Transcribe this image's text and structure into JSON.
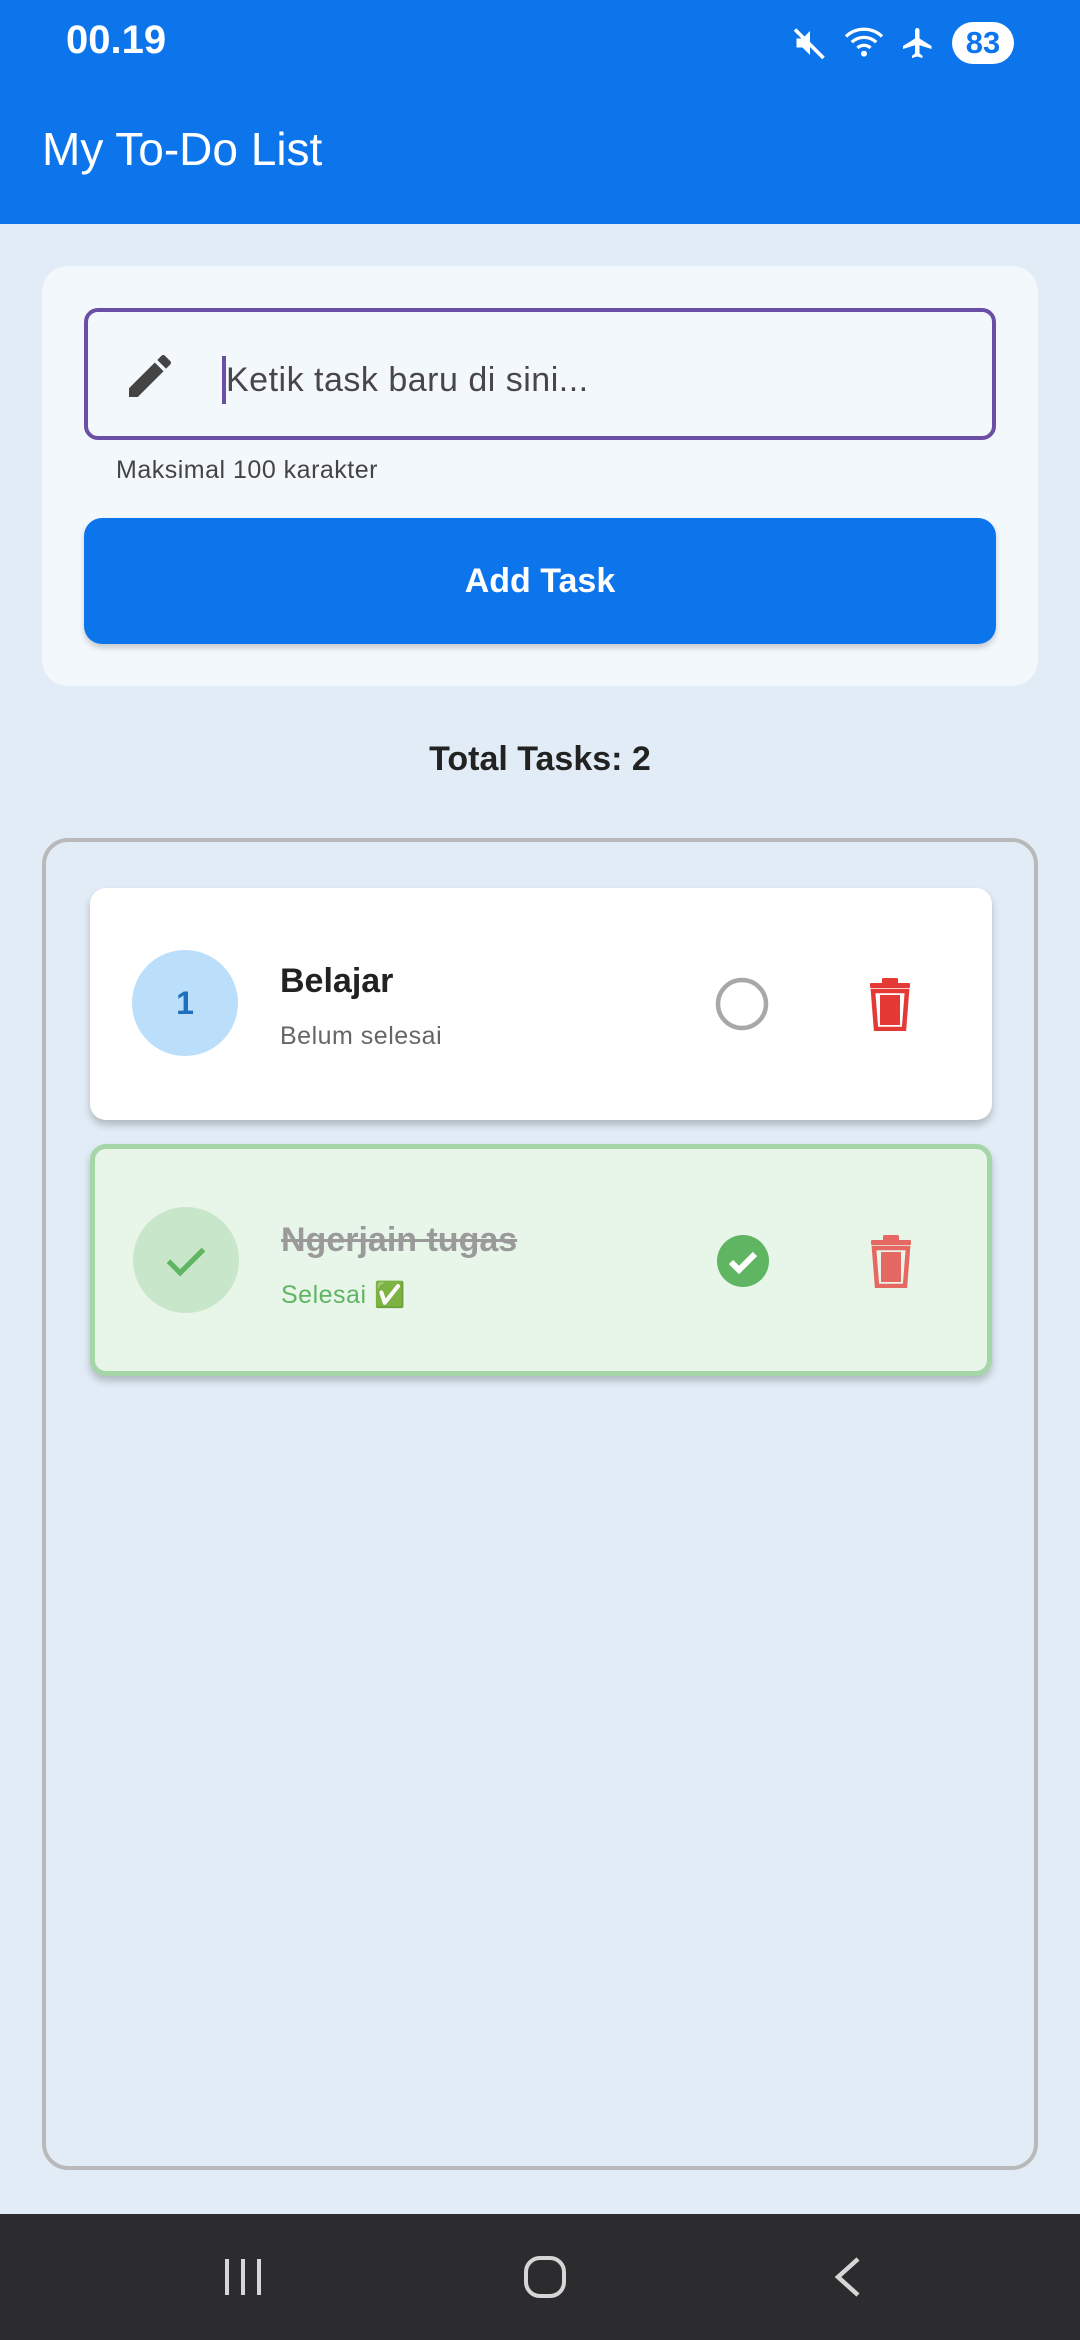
{
  "status_bar": {
    "time": "00.19",
    "battery": "83",
    "icons": [
      "mute-icon",
      "wifi-icon",
      "airplane-icon",
      "battery-icon"
    ]
  },
  "app_bar": {
    "title": "My To-Do List",
    "color": "#0c75ec"
  },
  "input": {
    "placeholder": "Ketik task baru di sini...",
    "helper": "Maksimal 100 karakter",
    "icon": "pencil-icon"
  },
  "add_button": {
    "label": "Add Task"
  },
  "total": {
    "text": "Total Tasks: 2"
  },
  "tasks": [
    {
      "badge": "1",
      "title": "Belajar",
      "status": "Belum selesai",
      "done": false
    },
    {
      "badge": "",
      "title": "Ngerjain tugas",
      "status": "Selesai ✅",
      "done": true
    }
  ],
  "colors": {
    "accent": "#0c75ec",
    "done_green": "#5fb562",
    "delete_red": "#e53935",
    "focus_border": "#6b4fa5"
  },
  "nav": {
    "icons": [
      "recent-apps-icon",
      "home-icon",
      "back-icon"
    ]
  }
}
